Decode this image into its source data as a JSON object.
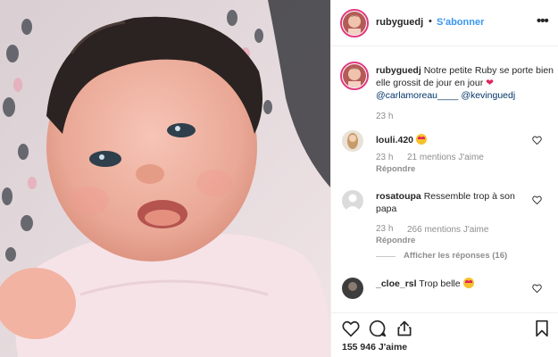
{
  "post": {
    "username": "rubyguedj",
    "separator": "•",
    "follow_label": "S'abonner",
    "more_label": "•••"
  },
  "caption": {
    "username": "rubyguedj",
    "text": "Notre petite Ruby se porte bien elle grossit de jour en jour",
    "emoji": "❤",
    "mention_1": "@carlamoreau____",
    "mention_2": "@kevinguedj",
    "time": "23 h"
  },
  "comments": [
    {
      "username": "louli.420",
      "text": "",
      "emoji": "heart-eyes-emoji",
      "time": "23 h",
      "likes": "21 mentions J'aime",
      "reply_label": "Répondre"
    },
    {
      "username": "rosatoupa",
      "text": "Ressemble trop à son papa",
      "time": "23 h",
      "likes": "266 mentions J'aime",
      "reply_label": "Répondre",
      "view_replies": "Afficher les réponses (16)"
    },
    {
      "username": "_cloe_rsl",
      "text": "Trop belle",
      "emoji": "heart-eyes-emoji"
    }
  ],
  "actions": {
    "like_icon": "heart-icon",
    "comment_icon": "comment-icon",
    "share_icon": "share-icon",
    "save_icon": "bookmark-icon",
    "likes_count": "155 946 J'aime"
  },
  "colors": {
    "follow_blue": "#3897f0",
    "mention_blue": "#003569",
    "muted_gray": "#8e8e8e",
    "heart_red": "#e0245e"
  }
}
